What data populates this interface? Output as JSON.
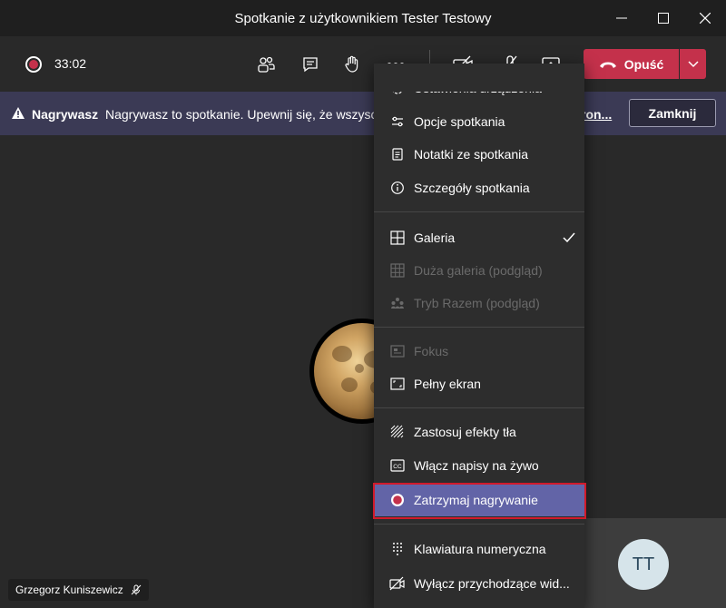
{
  "window": {
    "title": "Spotkanie z użytkownikiem Tester Testowy"
  },
  "toolbar": {
    "timer": "33:02",
    "leave_label": "Opuść",
    "icons": [
      "participants-icon",
      "chat-icon",
      "raise-hand-icon",
      "more-icon",
      "camera-off-icon",
      "mic-off-icon",
      "share-icon"
    ]
  },
  "banner": {
    "title": "Nagrywasz",
    "text": "Nagrywasz to spotkanie. Upewnij się, że wszyscy",
    "link": "ron...",
    "close_label": "Zamknij"
  },
  "menu": {
    "items": [
      {
        "label": "Ustawienia urządzenia",
        "icon": "gear-icon"
      },
      {
        "label": "Opcje spotkania",
        "icon": "sliders-icon"
      },
      {
        "label": "Notatki ze spotkania",
        "icon": "notes-icon"
      },
      {
        "label": "Szczegóły spotkania",
        "icon": "info-icon"
      },
      {
        "label": "Galeria",
        "icon": "gallery-icon",
        "checked": true
      },
      {
        "label": "Duża galeria (podgląd)",
        "icon": "large-gallery-icon",
        "disabled": true
      },
      {
        "label": "Tryb Razem (podgląd)",
        "icon": "together-mode-icon",
        "disabled": true
      },
      {
        "label": "Fokus",
        "icon": "focus-icon",
        "disabled": true
      },
      {
        "label": "Pełny ekran",
        "icon": "fullscreen-icon"
      },
      {
        "label": "Zastosuj efekty tła",
        "icon": "background-effects-icon"
      },
      {
        "label": "Włącz napisy na żywo",
        "icon": "captions-icon"
      },
      {
        "label": "Zatrzymaj nagrywanie",
        "icon": "stop-recording-icon",
        "active": true
      },
      {
        "label": "Klawiatura numeryczna",
        "icon": "dialpad-icon"
      },
      {
        "label": "Wyłącz przychodzące wid...",
        "icon": "video-off-icon"
      }
    ]
  },
  "participants": {
    "main_name": "Grzegorz Kuniszewicz",
    "tile_initials": "TT"
  },
  "colors": {
    "accent": "#6264a7",
    "leave": "#c4314b",
    "banner_bg": "#3b3a55",
    "highlight": "#d11a2a"
  }
}
